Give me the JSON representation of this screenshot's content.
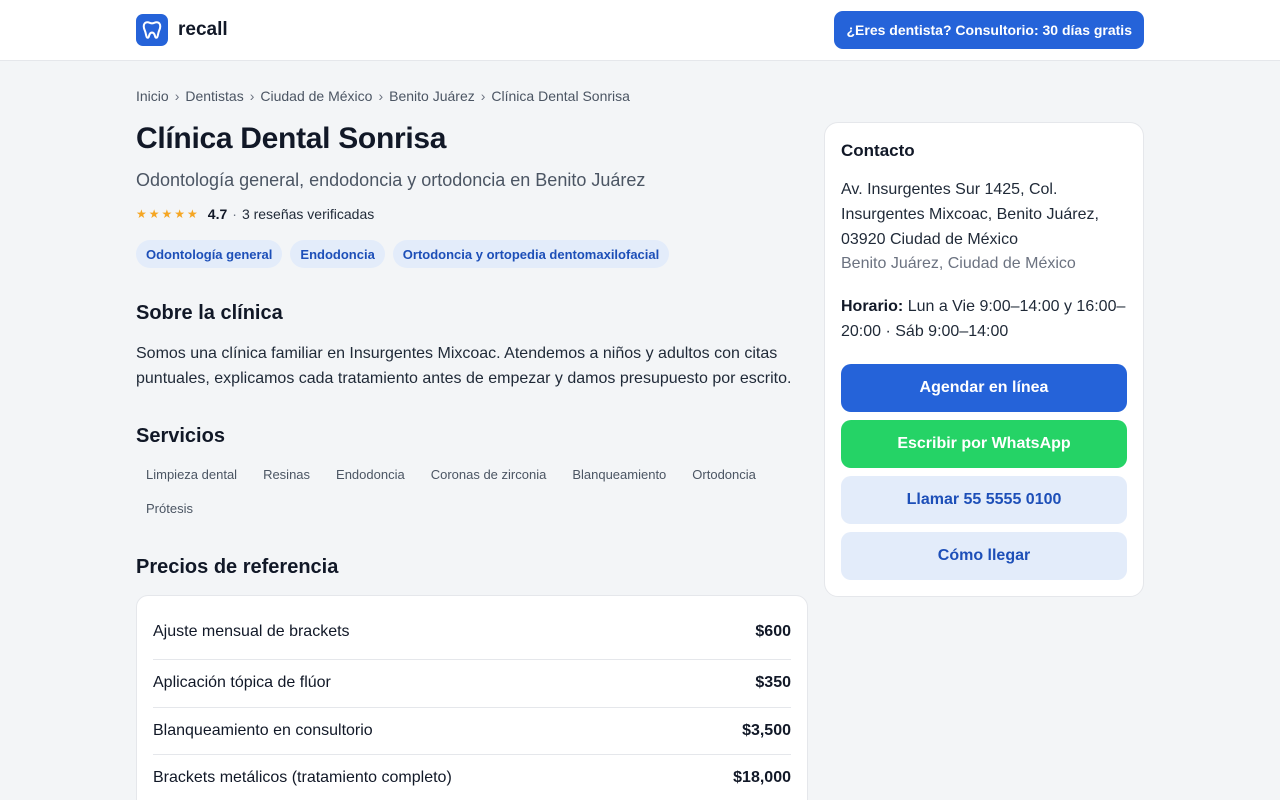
{
  "brand": {
    "name": "recall",
    "logo_icon": "tooth-icon",
    "color": "#2563d9"
  },
  "header": {
    "cta_label": "¿Eres dentista? Consultorio: 30 días gratis"
  },
  "breadcrumb": {
    "items": [
      "Inicio",
      "Dentistas",
      "Ciudad de México",
      "Benito Juárez",
      "Clínica Dental Sonrisa"
    ],
    "separator": "›"
  },
  "clinic": {
    "name": "Clínica Dental Sonrisa",
    "subtitle": "Odontología general, endodoncia y ortodoncia en Benito Juárez",
    "stars": "★★★★★",
    "rating": "4.7",
    "rating_separator": "·",
    "reviews_text": "3 reseñas verificadas",
    "specialties": [
      "Odontología general",
      "Endodoncia",
      "Ortodoncia y ortopedia dentomaxilofacial"
    ]
  },
  "about": {
    "title": "Sobre la clínica",
    "text": "Somos una clínica familiar en Insurgentes Mixcoac. Atendemos a niños y adultos con citas puntuales, explicamos cada tratamiento antes de empezar y damos presupuesto por escrito."
  },
  "services": {
    "title": "Servicios",
    "items": [
      "Limpieza dental",
      "Resinas",
      "Endodoncia",
      "Coronas de zirconia",
      "Blanqueamiento",
      "Ortodoncia",
      "Prótesis"
    ]
  },
  "prices": {
    "title": "Precios de referencia",
    "rows": [
      {
        "name": "Ajuste mensual de brackets",
        "price": "$600"
      },
      {
        "name": "Aplicación tópica de flúor",
        "price": "$350"
      },
      {
        "name": "Blanqueamiento en consultorio",
        "price": "$3,500"
      },
      {
        "name": "Brackets metálicos (tratamiento completo)",
        "price": "$18,000"
      }
    ]
  },
  "contact": {
    "title": "Contacto",
    "address": "Av. Insurgentes Sur 1425, Col. Insurgentes Mixcoac, Benito Juárez, 03920 Ciudad de México",
    "area": "Benito Juárez, Ciudad de México",
    "hours_label": "Horario:",
    "hours": "Lun a Vie 9:00–14:00 y 16:00–20:00 · Sáb 9:00–14:00",
    "buttons": {
      "book": "Agendar en línea",
      "whatsapp": "Escribir por WhatsApp",
      "call": "Llamar 55 5555 0100",
      "directions": "Cómo llegar"
    }
  },
  "colors": {
    "primary": "#2563d9",
    "whatsapp": "#25d366",
    "soft_blue": "#e3ecfa",
    "star": "#f5a623",
    "background": "#f3f5f7"
  }
}
